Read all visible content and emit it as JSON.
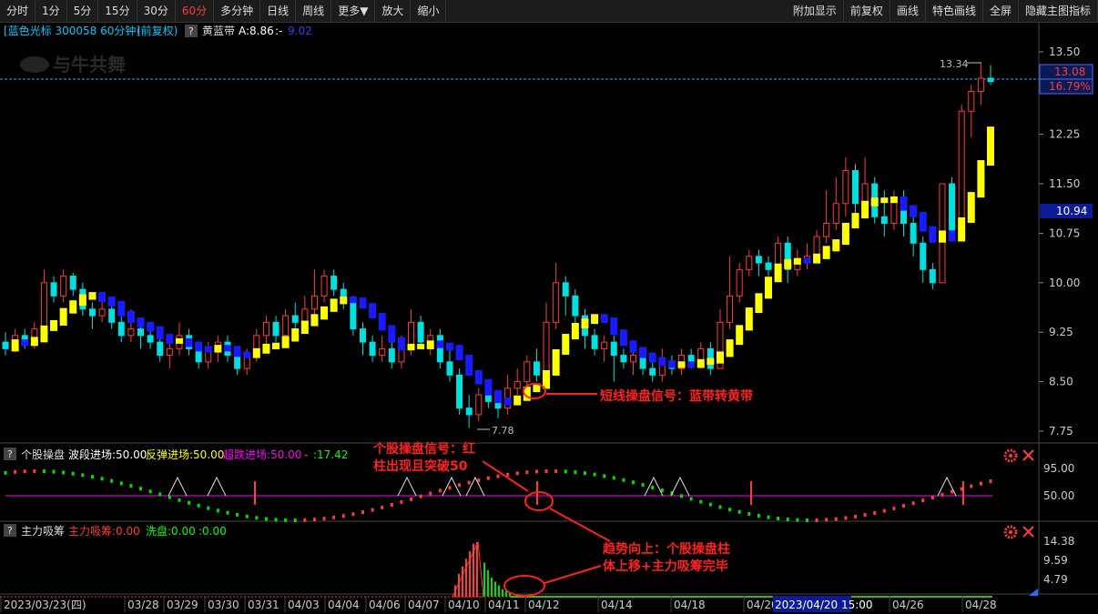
{
  "toolbar": {
    "left": [
      "分时",
      "1分",
      "5分",
      "15分",
      "30分",
      "60分",
      "多分钟",
      "日线",
      "周线",
      "更多▼",
      "放大",
      "缩小"
    ],
    "active": "60分",
    "right": [
      "附加显示",
      "前复权",
      "画线",
      "特色画线",
      "全屏",
      "隐藏主图指标"
    ]
  },
  "main_header": {
    "stock": "[蓝色光标 300058 60分钟]",
    "adjust": "(前复权)",
    "help": "?",
    "indicator": "黄蓝带",
    "a_value": "A:8.86",
    "sep": ":-",
    "b_value": "9.02"
  },
  "watermark": "与牛共舞",
  "price_axis": {
    "ticks": [
      "13.50",
      "12.25",
      "11.50",
      "10.75",
      "10.00",
      "9.25",
      "8.50",
      "7.75"
    ]
  },
  "price_labels": {
    "current": "13.08",
    "pct": "16.79%",
    "hover": "10.94",
    "high_mark": "13.34",
    "low_mark": "7.78"
  },
  "sub1": {
    "help": "?",
    "name": "个股操盘",
    "p1": "波段进场:50.00",
    "p2": "反弹进场:50.00",
    "p3": "超跌进场:50.00",
    "p4": "-",
    "p5": ":17.42",
    "ticks": [
      "95.00",
      "50.00"
    ]
  },
  "sub2": {
    "help": "?",
    "name": "主力吸筹",
    "p1": "主力吸筹:0.00",
    "p2": "洗盘:0.00",
    "p3": ":0.00",
    "ticks": [
      "14.38",
      "9.59",
      "4.79"
    ]
  },
  "date_axis": {
    "labels": [
      "2023/03/23(四)",
      "03/28",
      "03/29",
      "03/30",
      "03/31",
      "04/03",
      "04/04",
      "04/06",
      "04/07",
      "04/10",
      "04/11",
      "04/12",
      "04/14",
      "04/18",
      "04/20",
      "04/26",
      "04/28"
    ],
    "cursor_label": "2023/04/20 15:00"
  },
  "annotations": {
    "a1": "短线操盘信号：蓝带转黄带",
    "a2_line1": "个股操盘信号：红",
    "a2_line2": "柱出现且突破50",
    "a3_line1": "趋势向上：个股操盘柱",
    "a3_line2": "体上移+主力吸筹完毕"
  },
  "colors": {
    "up": "#ff3b3b",
    "down": "#00e0e0",
    "yellow_band": "#ffff00",
    "blue_band": "#1a1aff",
    "magenta": "#ff00ff",
    "annotation": "#ff2020"
  },
  "chart_data": {
    "type": "candlestick",
    "ylim": [
      7.75,
      13.5
    ],
    "candles": [
      [
        9.1,
        9.0,
        9.25,
        8.9
      ],
      [
        9.0,
        9.2,
        9.3,
        8.95
      ],
      [
        9.2,
        9.05,
        9.3,
        9.0
      ],
      [
        9.05,
        9.3,
        9.4,
        9.0
      ],
      [
        9.3,
        10.0,
        10.2,
        9.2
      ],
      [
        10.0,
        9.8,
        10.1,
        9.7
      ],
      [
        9.8,
        10.1,
        10.2,
        9.7
      ],
      [
        10.1,
        9.9,
        10.15,
        9.8
      ],
      [
        9.9,
        9.6,
        10.0,
        9.5
      ],
      [
        9.6,
        9.5,
        9.7,
        9.3
      ],
      [
        9.5,
        9.6,
        9.8,
        9.4
      ],
      [
        9.6,
        9.4,
        9.7,
        9.3
      ],
      [
        9.4,
        9.2,
        9.5,
        9.1
      ],
      [
        9.2,
        9.3,
        9.6,
        9.1
      ],
      [
        9.3,
        9.2,
        9.4,
        9.0
      ],
      [
        9.2,
        9.1,
        9.3,
        9.0
      ],
      [
        9.1,
        8.9,
        9.2,
        8.8
      ],
      [
        8.9,
        9.0,
        9.1,
        8.7
      ],
      [
        9.0,
        9.2,
        9.4,
        8.9
      ],
      [
        9.2,
        9.0,
        9.3,
        8.9
      ],
      [
        9.0,
        8.8,
        9.1,
        8.7
      ],
      [
        8.8,
        9.0,
        9.1,
        8.7
      ],
      [
        9.0,
        9.1,
        9.2,
        8.8
      ],
      [
        9.1,
        8.9,
        9.2,
        8.8
      ],
      [
        8.9,
        8.7,
        9.0,
        8.6
      ],
      [
        8.7,
        8.9,
        9.0,
        8.6
      ],
      [
        8.9,
        9.2,
        9.3,
        8.8
      ],
      [
        9.2,
        9.4,
        9.5,
        9.0
      ],
      [
        9.4,
        9.2,
        9.5,
        9.1
      ],
      [
        9.2,
        9.5,
        9.6,
        9.1
      ],
      [
        9.5,
        9.4,
        9.7,
        9.3
      ],
      [
        9.4,
        9.6,
        9.8,
        9.3
      ],
      [
        9.6,
        9.8,
        10.2,
        9.5
      ],
      [
        9.8,
        10.1,
        10.2,
        9.7
      ],
      [
        10.1,
        9.9,
        10.2,
        9.8
      ],
      [
        9.9,
        9.7,
        10.0,
        9.6
      ],
      [
        9.7,
        9.3,
        9.8,
        9.2
      ],
      [
        9.3,
        9.1,
        9.4,
        8.9
      ],
      [
        9.1,
        8.9,
        9.2,
        8.8
      ],
      [
        8.9,
        9.0,
        9.2,
        8.8
      ],
      [
        9.0,
        8.8,
        9.1,
        8.7
      ],
      [
        8.8,
        9.0,
        9.2,
        8.7
      ],
      [
        9.0,
        9.4,
        9.6,
        8.9
      ],
      [
        9.4,
        9.1,
        9.5,
        9.0
      ],
      [
        9.1,
        9.2,
        9.3,
        8.9
      ],
      [
        9.2,
        8.8,
        9.3,
        8.7
      ],
      [
        8.8,
        8.6,
        9.0,
        8.5
      ],
      [
        8.6,
        8.1,
        8.7,
        8.0
      ],
      [
        8.1,
        8.0,
        8.3,
        7.8
      ],
      [
        8.0,
        8.3,
        8.4,
        7.9
      ],
      [
        8.3,
        8.2,
        8.5,
        8.1
      ],
      [
        8.2,
        8.1,
        8.3,
        7.95
      ],
      [
        8.1,
        8.4,
        8.6,
        8.0
      ],
      [
        8.4,
        8.5,
        8.7,
        8.3
      ],
      [
        8.5,
        8.8,
        8.9,
        8.4
      ],
      [
        8.8,
        8.6,
        9.0,
        8.5
      ],
      [
        8.6,
        9.4,
        9.7,
        8.5
      ],
      [
        9.4,
        10.0,
        10.3,
        9.3
      ],
      [
        10.0,
        9.8,
        10.1,
        9.5
      ],
      [
        9.8,
        9.5,
        9.9,
        9.3
      ],
      [
        9.5,
        9.2,
        9.6,
        9.0
      ],
      [
        9.2,
        9.0,
        9.3,
        8.9
      ],
      [
        9.0,
        9.1,
        9.2,
        8.8
      ],
      [
        9.1,
        8.9,
        9.2,
        8.5
      ],
      [
        8.9,
        8.8,
        9.0,
        8.7
      ],
      [
        8.8,
        8.9,
        9.0,
        8.6
      ],
      [
        8.9,
        8.7,
        9.0,
        8.6
      ],
      [
        8.7,
        8.6,
        8.8,
        8.5
      ],
      [
        8.6,
        8.8,
        9.0,
        8.5
      ],
      [
        8.8,
        8.7,
        8.9,
        8.6
      ],
      [
        8.7,
        8.9,
        9.0,
        8.6
      ],
      [
        8.9,
        8.8,
        9.0,
        8.7
      ],
      [
        8.8,
        9.0,
        9.1,
        8.7
      ],
      [
        9.0,
        8.7,
        9.1,
        8.6
      ],
      [
        8.7,
        9.4,
        9.6,
        8.7
      ],
      [
        9.4,
        9.8,
        10.4,
        9.3
      ],
      [
        9.8,
        10.2,
        10.3,
        9.7
      ],
      [
        10.2,
        10.4,
        10.5,
        10.1
      ],
      [
        10.4,
        10.3,
        10.5,
        10.1
      ],
      [
        10.3,
        10.2,
        10.4,
        10.1
      ],
      [
        10.2,
        10.6,
        10.7,
        10.1
      ],
      [
        10.6,
        10.2,
        10.7,
        10.0
      ],
      [
        10.2,
        10.3,
        10.5,
        10.1
      ],
      [
        10.3,
        10.4,
        10.6,
        10.2
      ],
      [
        10.4,
        10.7,
        10.8,
        10.3
      ],
      [
        10.7,
        10.9,
        11.4,
        10.6
      ],
      [
        10.9,
        11.2,
        11.6,
        10.8
      ],
      [
        11.2,
        11.7,
        11.9,
        11.0
      ],
      [
        11.7,
        11.2,
        11.8,
        11.0
      ],
      [
        11.2,
        11.5,
        11.9,
        11.1
      ],
      [
        11.5,
        11.0,
        11.6,
        10.9
      ],
      [
        11.0,
        10.9,
        11.4,
        10.7
      ],
      [
        10.9,
        11.3,
        11.4,
        10.8
      ],
      [
        11.3,
        10.9,
        11.4,
        10.7
      ],
      [
        10.9,
        10.6,
        11.0,
        10.4
      ],
      [
        10.6,
        10.2,
        10.7,
        10.0
      ],
      [
        10.2,
        10.0,
        10.3,
        9.9
      ],
      [
        10.0,
        11.5,
        11.5,
        10.0
      ],
      [
        11.5,
        10.8,
        11.6,
        10.7
      ],
      [
        10.8,
        12.6,
        12.7,
        10.8
      ],
      [
        12.6,
        12.9,
        13.0,
        12.2
      ],
      [
        12.9,
        13.1,
        13.34,
        12.7
      ],
      [
        13.1,
        13.05,
        13.3,
        13.0
      ]
    ]
  }
}
